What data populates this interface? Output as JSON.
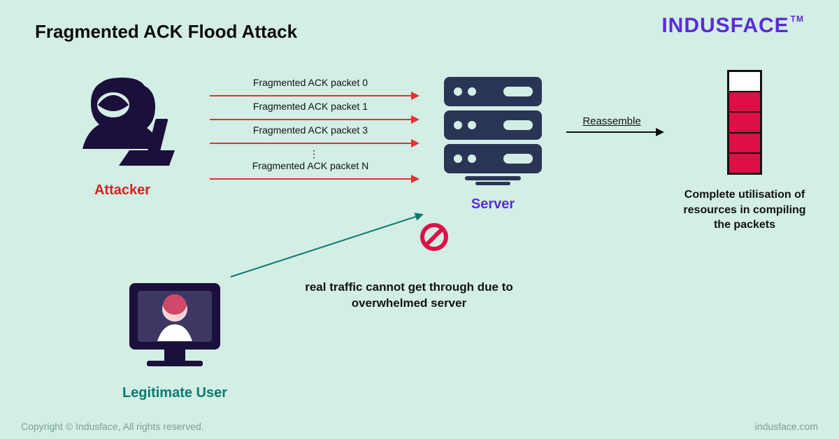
{
  "title": "Fragmented ACK Flood Attack",
  "brand": "INDUSFACE",
  "brand_tm": "TM",
  "attacker": {
    "label": "Attacker"
  },
  "packets": {
    "p0": "Fragmented ACK packet 0",
    "p1": "Fragmented ACK packet 1",
    "p3": "Fragmented ACK packet 3",
    "pN": "Fragmented ACK packet N"
  },
  "server": {
    "label": "Server"
  },
  "reassemble": {
    "label": "Reassemble"
  },
  "resources": {
    "label": "Complete utilisation of resources in compiling the packets"
  },
  "user": {
    "label": "Legitimate User"
  },
  "blocked": {
    "text": "real traffic cannot get through due to overwhelmed server"
  },
  "footer": {
    "left": "Copyright © Indusface, All rights reserved.",
    "right": "indusface.com"
  }
}
